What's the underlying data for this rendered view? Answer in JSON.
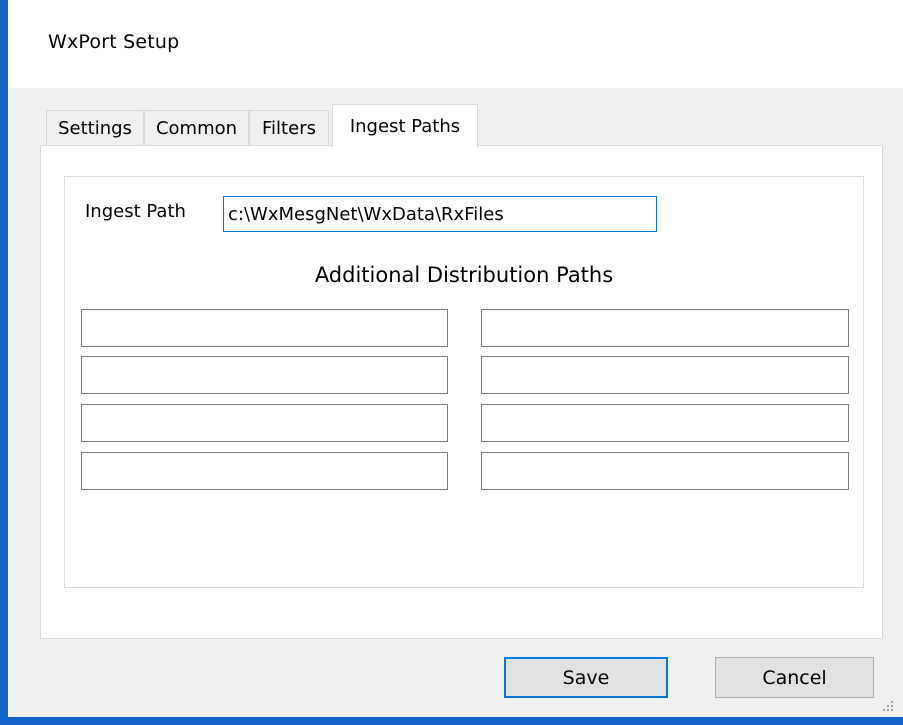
{
  "window": {
    "title": "WxPort Setup"
  },
  "tabs": [
    {
      "label": "Settings"
    },
    {
      "label": "Common"
    },
    {
      "label": "Filters"
    },
    {
      "label": "Ingest Paths",
      "active": true
    }
  ],
  "ingest": {
    "label": "Ingest Path",
    "value": "c:\\WxMesgNet\\WxData\\RxFiles"
  },
  "distribution": {
    "heading": "Additional Distribution Paths",
    "paths": [
      "",
      "",
      "",
      "",
      "",
      "",
      "",
      ""
    ]
  },
  "buttons": {
    "save": "Save",
    "cancel": "Cancel"
  },
  "colors": {
    "accent": "#0078d7",
    "window_border": "#1464c8",
    "client_bg": "#f0f0f0"
  }
}
